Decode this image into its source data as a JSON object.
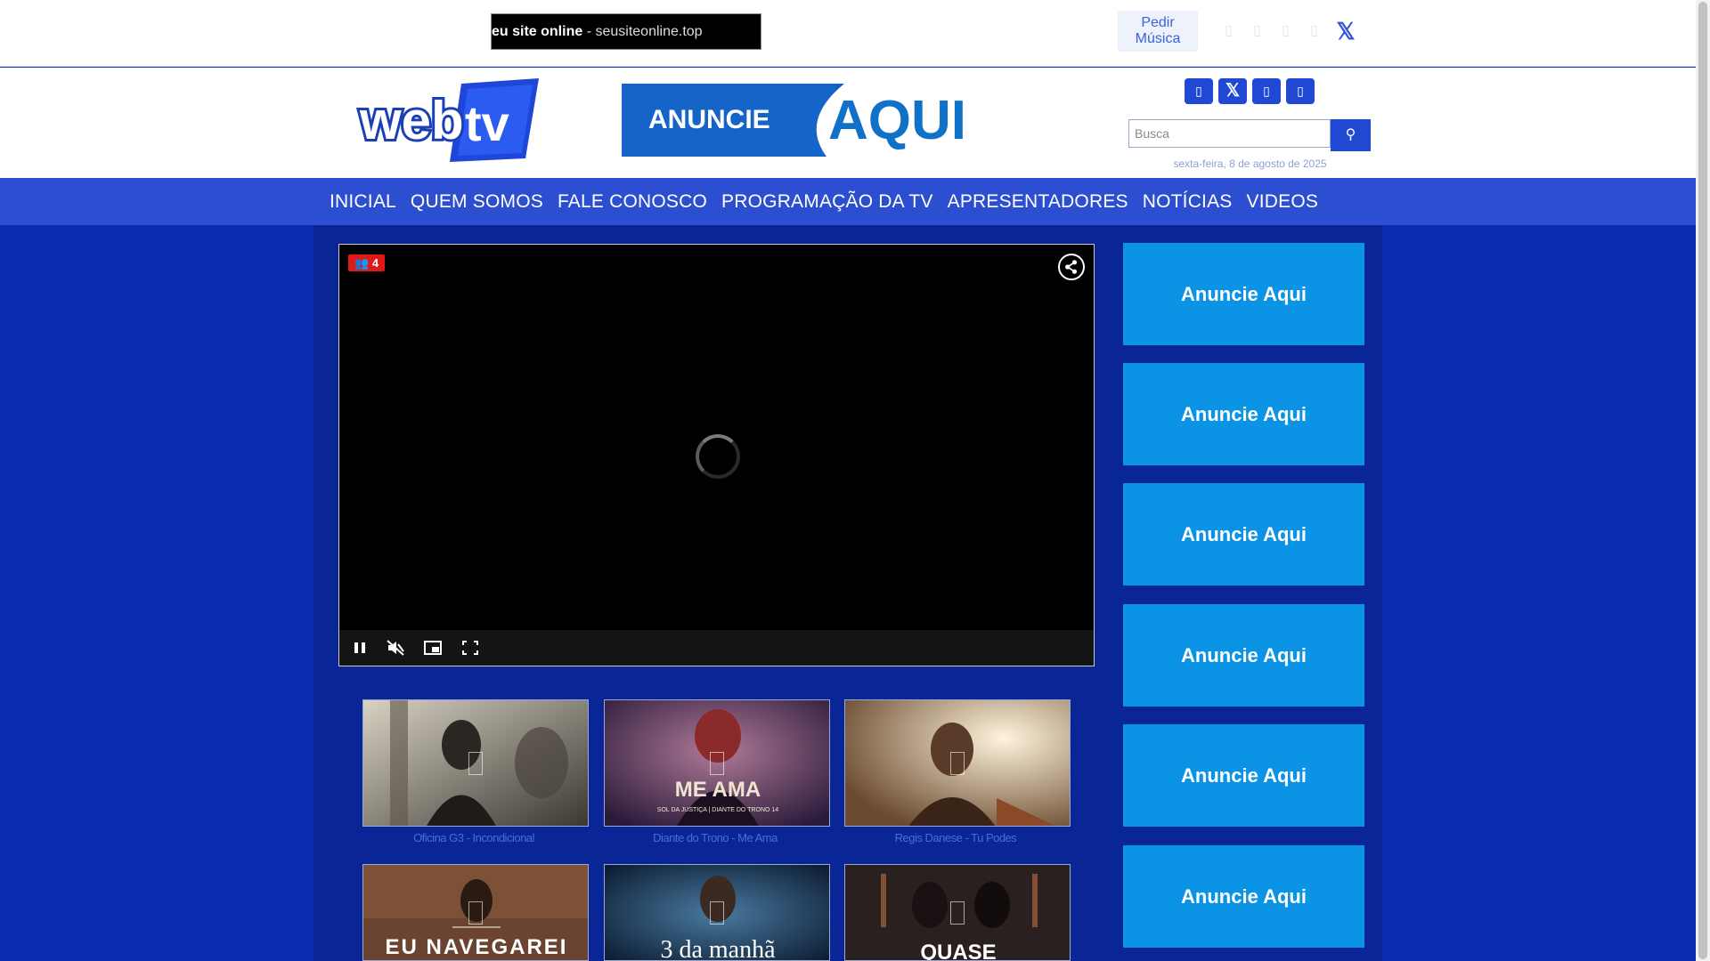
{
  "topbar": {
    "marquee_bold": "eu site online",
    "marquee_rest": " - seusiteonline.top",
    "pedir_line1": "Pedir",
    "pedir_line2": "Música",
    "x_glyph": "𝕏"
  },
  "header": {
    "logo_text_a": "web",
    "logo_text_b": "tv",
    "banner_word1": "ANUNCIE",
    "banner_word2": "AQUI",
    "search_placeholder": "Busca",
    "search_glyph": "⚲",
    "date": "sexta-feira, 8 de agosto de 2025",
    "x_glyph": "𝕏"
  },
  "nav": {
    "items": [
      "INICIAL",
      "QUEM SOMOS",
      "FALE CONOSCO",
      "PROGRAMAÇÃO DA TV",
      "APRESENTADORES",
      "NOTÍCIAS",
      "VIDEOS"
    ]
  },
  "player": {
    "viewers": "4",
    "viewer_glyph": "👥"
  },
  "videos": [
    {
      "caption": "Oficina G3 - Incondicional",
      "overlay": ""
    },
    {
      "caption": "Diante do Trono - Me Ama",
      "overlay": "ME AMA",
      "sub": "SOL DA JUSTIÇA | DIANTE DO TRONO 14"
    },
    {
      "caption": "Regis Danese - Tu Podes",
      "overlay": ""
    },
    {
      "caption": "",
      "overlay": "EU NAVEGAREI"
    },
    {
      "caption": "",
      "overlay": "3 da manhã"
    },
    {
      "caption": "",
      "overlay": "QUASE"
    }
  ],
  "ads": [
    "Anuncie Aqui",
    "Anuncie Aqui",
    "Anuncie Aqui",
    "Anuncie Aqui",
    "Anuncie Aqui",
    "Anuncie Aqui"
  ],
  "colors": {
    "brand_blue": "#2b4fd0",
    "background": "#0b2bb0",
    "ad_blue": "#0b94e6",
    "live_red": "#e01818"
  }
}
